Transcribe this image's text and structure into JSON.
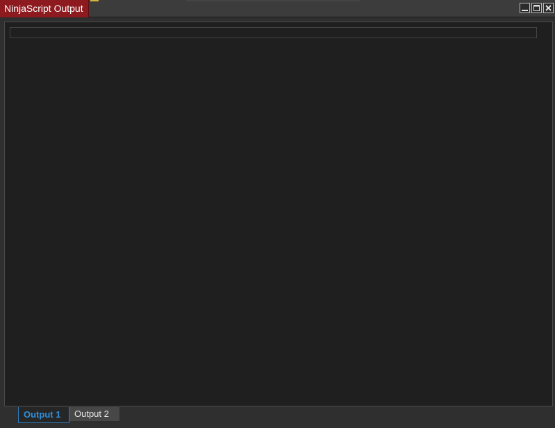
{
  "window": {
    "title": "NinjaScript Output",
    "title_color": "#8d1a1f"
  },
  "controls": {
    "minimize_icon": "minimize-icon",
    "maximize_icon": "maximize-icon",
    "close_icon": "close-icon"
  },
  "output": {
    "text": ""
  },
  "tabs": [
    {
      "label": "Output 1",
      "active": true
    },
    {
      "label": "Output 2",
      "active": false
    }
  ],
  "colors": {
    "active_tab": "#2f8fdc",
    "background": "#1f1f1f"
  }
}
